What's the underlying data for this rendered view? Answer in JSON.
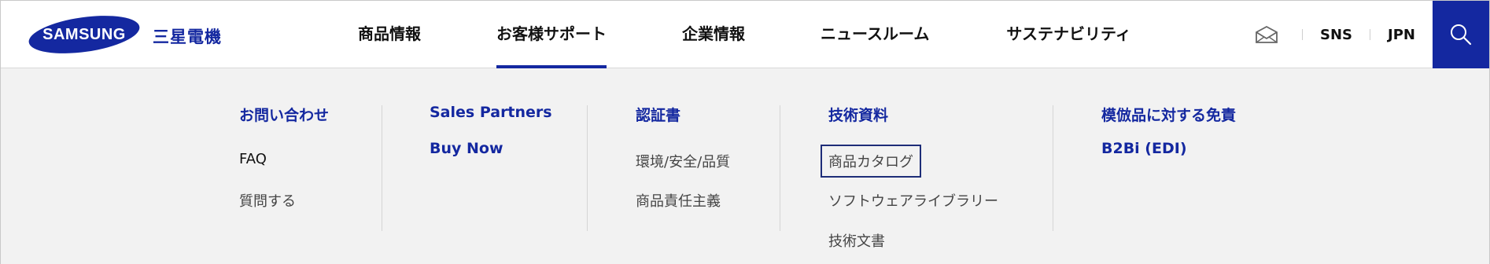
{
  "brand": {
    "logo_text": "SAMSUNG",
    "sub_name": "三星電機",
    "color": "#1428a0"
  },
  "nav": {
    "items": [
      {
        "label": "商品情報"
      },
      {
        "label": "お客様サポート",
        "active": true
      },
      {
        "label": "企業情報"
      },
      {
        "label": "ニュースルーム"
      },
      {
        "label": "サステナビリティ"
      }
    ]
  },
  "utility": {
    "mail_icon": "mail-icon",
    "sns_label": "SNS",
    "lang_label": "JPN",
    "search_icon": "search-icon"
  },
  "mega_menu": {
    "columns": [
      {
        "heading": "お問い合わせ",
        "links": [
          "FAQ",
          "質問する"
        ]
      },
      {
        "headings": [
          "Sales Partners",
          "Buy Now"
        ]
      },
      {
        "heading": "認証書",
        "links": [
          "環境/安全/品質",
          "商品責任主義"
        ]
      },
      {
        "heading": "技術資料",
        "links": [
          "商品カタログ",
          "ソフトウェアライブラリー",
          "技術文書"
        ],
        "focused": "商品カタログ"
      },
      {
        "headings": [
          "模倣品に対する免責",
          "B2Bi (EDI)"
        ]
      }
    ]
  }
}
